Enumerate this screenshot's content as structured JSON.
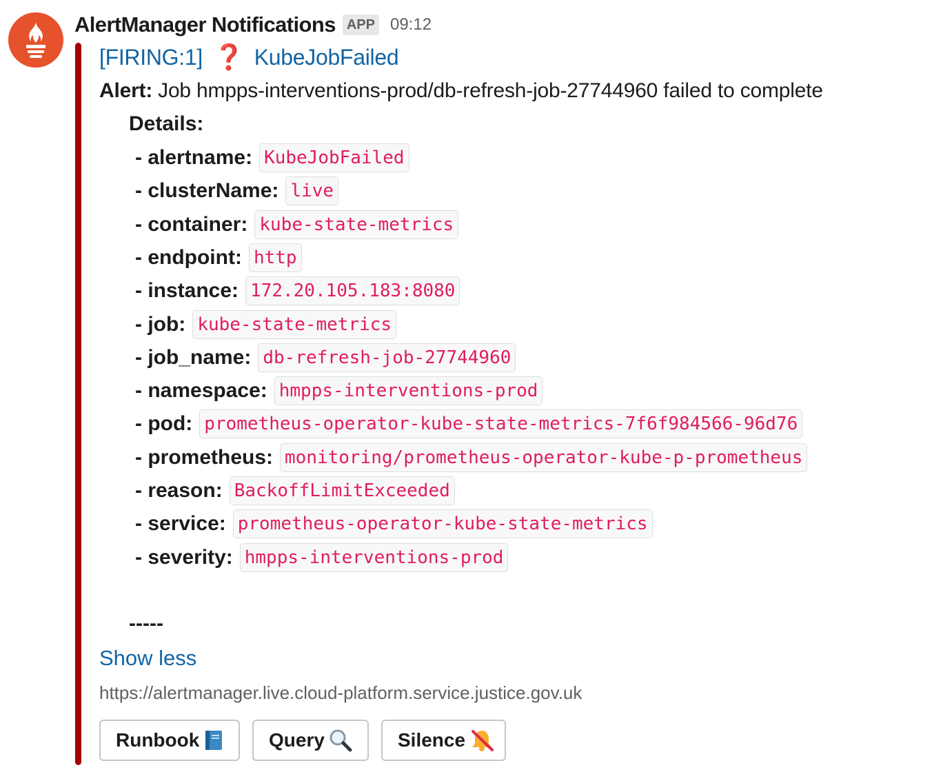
{
  "message": {
    "sender": "AlertManager Notifications",
    "badge": "APP",
    "time": "09:12",
    "avatar_icon": "prometheus-flame-icon",
    "accent_color": "#a30200",
    "title_prefix": "[FIRING:1]",
    "title_icon": "red-question-mark-icon",
    "title_icon_char": "❓",
    "title_name": "KubeJobFailed",
    "alert_label": "Alert:",
    "alert_text": "Job hmpps-interventions-prod/db-refresh-job-27744960 failed to complete",
    "details_label": "Details:",
    "details": [
      {
        "key": "- alertname:",
        "value": "KubeJobFailed"
      },
      {
        "key": "- clusterName:",
        "value": "live"
      },
      {
        "key": "- container:",
        "value": "kube-state-metrics"
      },
      {
        "key": "- endpoint:",
        "value": "http"
      },
      {
        "key": "- instance:",
        "value": "172.20.105.183:8080"
      },
      {
        "key": "- job:",
        "value": "kube-state-metrics"
      },
      {
        "key": "- job_name:",
        "value": "db-refresh-job-27744960"
      },
      {
        "key": "- namespace:",
        "value": "hmpps-interventions-prod"
      },
      {
        "key": "- pod:",
        "value": "prometheus-operator-kube-state-metrics-7f6f984566-96d76"
      },
      {
        "key": "- prometheus:",
        "value": "monitoring/prometheus-operator-kube-p-prometheus"
      },
      {
        "key": "- reason:",
        "value": "BackoffLimitExceeded"
      },
      {
        "key": "- service:",
        "value": "prometheus-operator-kube-state-metrics"
      },
      {
        "key": "- severity:",
        "value": "hmpps-interventions-prod"
      }
    ],
    "separator": "-----",
    "show_less": "Show less",
    "url": "https://alertmanager.live.cloud-platform.service.justice.gov.uk"
  },
  "buttons": [
    {
      "label": "Runbook",
      "icon": "blue-book-icon"
    },
    {
      "label": "Query",
      "icon": "magnifying-glass-icon"
    },
    {
      "label": "Silence",
      "icon": "muted-bell-icon"
    }
  ]
}
